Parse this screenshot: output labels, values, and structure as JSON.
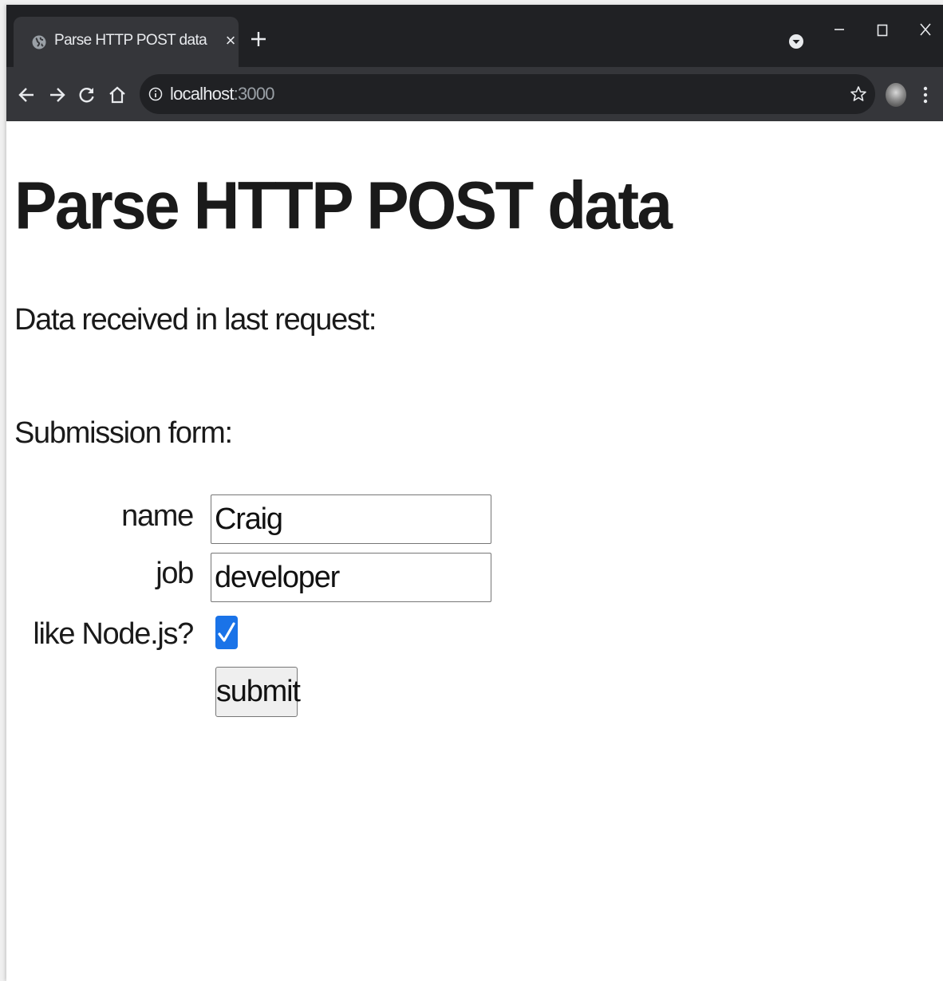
{
  "browser": {
    "tab_title": "Parse HTTP POST data",
    "tab_close_glyph": "×",
    "url_host": "localhost",
    "url_port": ":3000",
    "icons": [
      "globe-icon",
      "close-icon",
      "plus-icon",
      "profile-dropdown-icon",
      "minimize-icon",
      "maximize-icon",
      "window-close-icon",
      "back-arrow-icon",
      "forward-arrow-icon",
      "reload-icon",
      "home-icon",
      "info-icon",
      "star-icon",
      "avatar",
      "kebab-menu-icon"
    ],
    "colors": {
      "titlebar": "#202124",
      "toolbar": "#35363a",
      "checkbox_accent": "#1a73e8"
    }
  },
  "page": {
    "title": "Parse HTTP POST data",
    "data_received_label": "Data received in last request:",
    "submission_form_label": "Submission form:"
  },
  "form": {
    "name_label": "name",
    "name_value": "Craig",
    "job_label": "job",
    "job_value": "developer",
    "like_label": "like Node.js?",
    "like_checked": true,
    "submit_label": "submit"
  }
}
